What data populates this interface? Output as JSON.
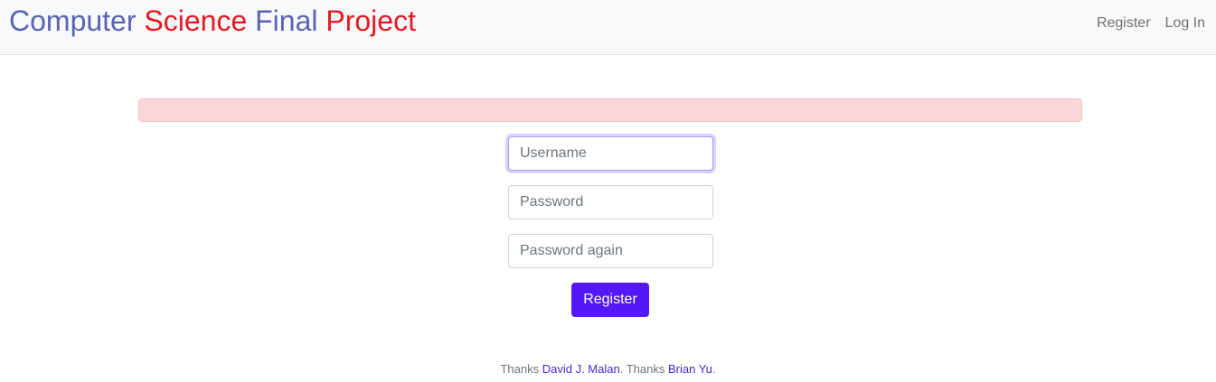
{
  "header": {
    "brand": {
      "word1": "Computer",
      "word2": "Science",
      "word3": "Final",
      "word4": "Project"
    },
    "nav": {
      "register": "Register",
      "login": "Log In"
    }
  },
  "form": {
    "username": {
      "placeholder": "Username",
      "value": ""
    },
    "password": {
      "placeholder": "Password",
      "value": ""
    },
    "password_again": {
      "placeholder": "Password again",
      "value": ""
    },
    "submit_label": "Register"
  },
  "footer": {
    "thanks1": "Thanks",
    "link1": "David J. Malan",
    "sep": ".",
    "thanks2": "Thanks",
    "link2": "Brian Yu",
    "end": "."
  },
  "colors": {
    "brand_blue": "#5b63b7",
    "brand_red": "#e31b23",
    "primary_button": "#5518f9",
    "alert_bg": "#f8d7da",
    "link": "#4a26d9"
  }
}
